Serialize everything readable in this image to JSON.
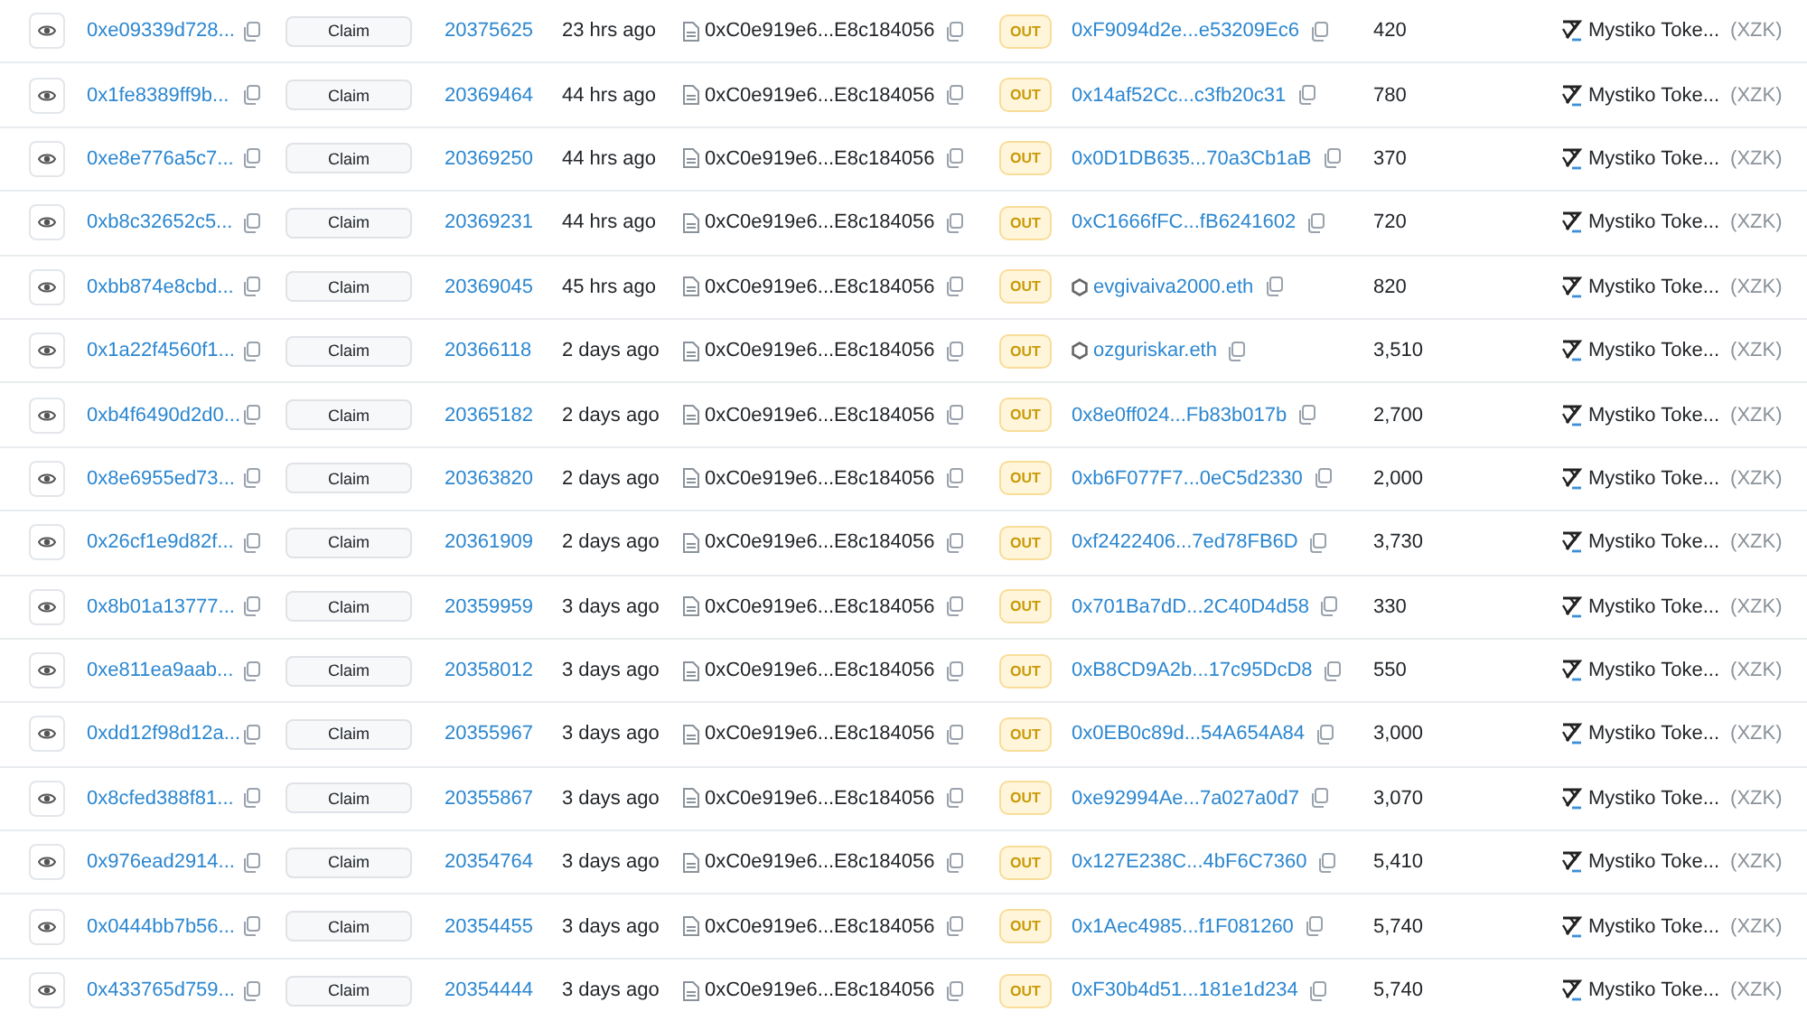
{
  "rows": [
    {
      "tx_hash": "0xe09339d728...",
      "method": "Claim",
      "block": "20375625",
      "age": "23 hrs ago",
      "from": "0xC0e919e6...E8c184056",
      "direction": "OUT",
      "to": {
        "kind": "address",
        "text": "0xF9094d2e...e53209Ec6"
      },
      "value": "420",
      "token_name": "Mystiko Toke...",
      "token_symbol": "(XZK)"
    },
    {
      "tx_hash": "0x1fe8389ff9b...",
      "method": "Claim",
      "block": "20369464",
      "age": "44 hrs ago",
      "from": "0xC0e919e6...E8c184056",
      "direction": "OUT",
      "to": {
        "kind": "address",
        "text": "0x14af52Cc...c3fb20c31"
      },
      "value": "780",
      "token_name": "Mystiko Toke...",
      "token_symbol": "(XZK)"
    },
    {
      "tx_hash": "0xe8e776a5c7...",
      "method": "Claim",
      "block": "20369250",
      "age": "44 hrs ago",
      "from": "0xC0e919e6...E8c184056",
      "direction": "OUT",
      "to": {
        "kind": "address",
        "text": "0x0D1DB635...70a3Cb1aB"
      },
      "value": "370",
      "token_name": "Mystiko Toke...",
      "token_symbol": "(XZK)"
    },
    {
      "tx_hash": "0xb8c32652c5...",
      "method": "Claim",
      "block": "20369231",
      "age": "44 hrs ago",
      "from": "0xC0e919e6...E8c184056",
      "direction": "OUT",
      "to": {
        "kind": "address",
        "text": "0xC1666fFC...fB6241602"
      },
      "value": "720",
      "token_name": "Mystiko Toke...",
      "token_symbol": "(XZK)"
    },
    {
      "tx_hash": "0xbb874e8cbd...",
      "method": "Claim",
      "block": "20369045",
      "age": "45 hrs ago",
      "from": "0xC0e919e6...E8c184056",
      "direction": "OUT",
      "to": {
        "kind": "ens",
        "text": "evgivaiva2000.eth"
      },
      "value": "820",
      "token_name": "Mystiko Toke...",
      "token_symbol": "(XZK)"
    },
    {
      "tx_hash": "0x1a22f4560f1...",
      "method": "Claim",
      "block": "20366118",
      "age": "2 days ago",
      "from": "0xC0e919e6...E8c184056",
      "direction": "OUT",
      "to": {
        "kind": "ens",
        "text": "ozguriskar.eth"
      },
      "value": "3,510",
      "token_name": "Mystiko Toke...",
      "token_symbol": "(XZK)"
    },
    {
      "tx_hash": "0xb4f6490d2d0...",
      "method": "Claim",
      "block": "20365182",
      "age": "2 days ago",
      "from": "0xC0e919e6...E8c184056",
      "direction": "OUT",
      "to": {
        "kind": "address",
        "text": "0x8e0ff024...Fb83b017b"
      },
      "value": "2,700",
      "token_name": "Mystiko Toke...",
      "token_symbol": "(XZK)"
    },
    {
      "tx_hash": "0x8e6955ed73...",
      "method": "Claim",
      "block": "20363820",
      "age": "2 days ago",
      "from": "0xC0e919e6...E8c184056",
      "direction": "OUT",
      "to": {
        "kind": "address",
        "text": "0xb6F077F7...0eC5d2330"
      },
      "value": "2,000",
      "token_name": "Mystiko Toke...",
      "token_symbol": "(XZK)"
    },
    {
      "tx_hash": "0x26cf1e9d82f...",
      "method": "Claim",
      "block": "20361909",
      "age": "2 days ago",
      "from": "0xC0e919e6...E8c184056",
      "direction": "OUT",
      "to": {
        "kind": "address",
        "text": "0xf2422406...7ed78FB6D"
      },
      "value": "3,730",
      "token_name": "Mystiko Toke...",
      "token_symbol": "(XZK)"
    },
    {
      "tx_hash": "0x8b01a13777...",
      "method": "Claim",
      "block": "20359959",
      "age": "3 days ago",
      "from": "0xC0e919e6...E8c184056",
      "direction": "OUT",
      "to": {
        "kind": "address",
        "text": "0x701Ba7dD...2C40D4d58"
      },
      "value": "330",
      "token_name": "Mystiko Toke...",
      "token_symbol": "(XZK)"
    },
    {
      "tx_hash": "0xe811ea9aab...",
      "method": "Claim",
      "block": "20358012",
      "age": "3 days ago",
      "from": "0xC0e919e6...E8c184056",
      "direction": "OUT",
      "to": {
        "kind": "address",
        "text": "0xB8CD9A2b...17c95DcD8"
      },
      "value": "550",
      "token_name": "Mystiko Toke...",
      "token_symbol": "(XZK)"
    },
    {
      "tx_hash": "0xdd12f98d12a...",
      "method": "Claim",
      "block": "20355967",
      "age": "3 days ago",
      "from": "0xC0e919e6...E8c184056",
      "direction": "OUT",
      "to": {
        "kind": "address",
        "text": "0x0EB0c89d...54A654A84"
      },
      "value": "3,000",
      "token_name": "Mystiko Toke...",
      "token_symbol": "(XZK)"
    },
    {
      "tx_hash": "0x8cfed388f81...",
      "method": "Claim",
      "block": "20355867",
      "age": "3 days ago",
      "from": "0xC0e919e6...E8c184056",
      "direction": "OUT",
      "to": {
        "kind": "address",
        "text": "0xe92994Ae...7a027a0d7"
      },
      "value": "3,070",
      "token_name": "Mystiko Toke...",
      "token_symbol": "(XZK)"
    },
    {
      "tx_hash": "0x976ead2914...",
      "method": "Claim",
      "block": "20354764",
      "age": "3 days ago",
      "from": "0xC0e919e6...E8c184056",
      "direction": "OUT",
      "to": {
        "kind": "address",
        "text": "0x127E238C...4bF6C7360"
      },
      "value": "5,410",
      "token_name": "Mystiko Toke...",
      "token_symbol": "(XZK)"
    },
    {
      "tx_hash": "0x0444bb7b56...",
      "method": "Claim",
      "block": "20354455",
      "age": "3 days ago",
      "from": "0xC0e919e6...E8c184056",
      "direction": "OUT",
      "to": {
        "kind": "address",
        "text": "0x1Aec4985...f1F081260"
      },
      "value": "5,740",
      "token_name": "Mystiko Toke...",
      "token_symbol": "(XZK)"
    },
    {
      "tx_hash": "0x433765d759...",
      "method": "Claim",
      "block": "20354444",
      "age": "3 days ago",
      "from": "0xC0e919e6...E8c184056",
      "direction": "OUT",
      "to": {
        "kind": "address",
        "text": "0xF30b4d51...181e1d234"
      },
      "value": "5,740",
      "token_name": "Mystiko Toke...",
      "token_symbol": "(XZK)"
    }
  ]
}
